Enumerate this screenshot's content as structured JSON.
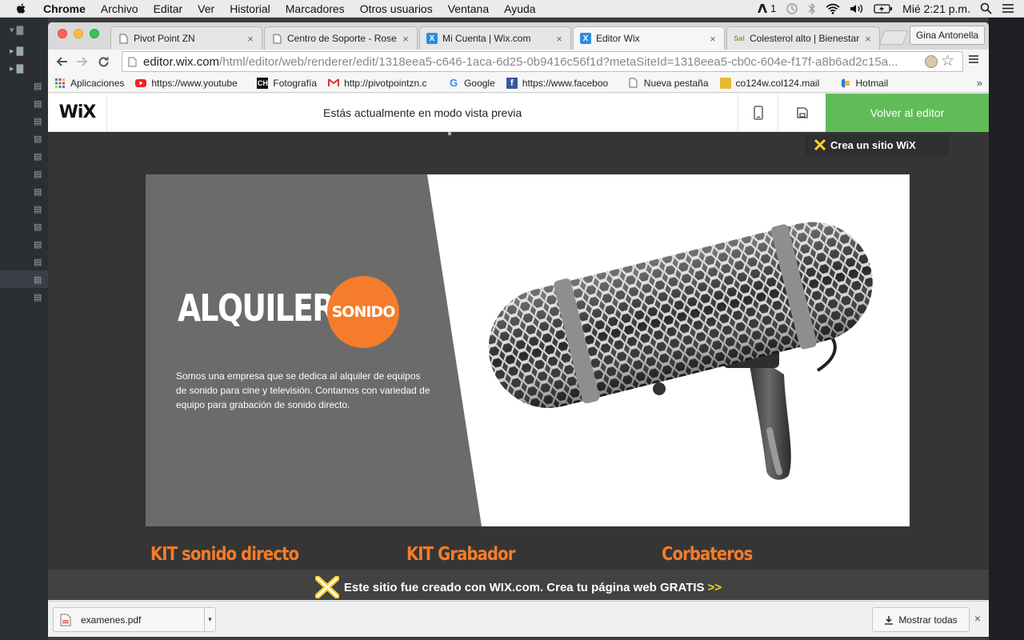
{
  "menubar": {
    "app": "Chrome",
    "items": [
      "Archivo",
      "Editar",
      "Ver",
      "Historial",
      "Marcadores",
      "Otros usuarios",
      "Ventana",
      "Ayuda"
    ],
    "status_count": "1",
    "clock": "Mié 2:21 p.m."
  },
  "tabs": [
    {
      "title": "Pivot Point ZN",
      "favicon": "page-icon",
      "active": false
    },
    {
      "title": "Centro de Soporte - Rose",
      "favicon": "page-icon",
      "active": false
    },
    {
      "title": "Mi Cuenta | Wix.com",
      "favicon": "wix-icon",
      "active": false
    },
    {
      "title": "Editor Wix",
      "favicon": "wix-icon",
      "active": true
    },
    {
      "title": "Colesterol alto | Bienestar",
      "favicon": "sal-icon",
      "active": false
    }
  ],
  "profile": "Gina Antonella",
  "omnibox": {
    "host": "editor.wix.com",
    "path": "/html/editor/web/renderer/edit/1318eea5-c646-1aca-6d25-0b9416c56f1d?metaSiteId=1318eea5-cb0c-604e-f17f-a8b6ad2c15a..."
  },
  "bookmarks": [
    {
      "label": "Aplicaciones",
      "icon": "apps-grid-icon"
    },
    {
      "label": "https://www.youtube",
      "icon": "youtube-icon"
    },
    {
      "label": "Fotografía",
      "icon": "camera-icon"
    },
    {
      "label": "http://pivotpointzn.c",
      "icon": "gmail-icon"
    },
    {
      "label": "Google",
      "icon": "google-icon"
    },
    {
      "label": "https://www.faceboo",
      "icon": "facebook-icon"
    },
    {
      "label": "Nueva pestaña",
      "icon": "page-icon"
    },
    {
      "label": "co124w.col124.mail",
      "icon": "outlook-icon"
    },
    {
      "label": "Hotmail",
      "icon": "hotmail-icon"
    }
  ],
  "wix": {
    "logo": "WiX",
    "preview_message": "Estás actualmente en modo vista previa",
    "back_to_editor": "Volver al editor",
    "create_badge": "Crea un sitio WiX"
  },
  "hero": {
    "title": "ALQUILER",
    "badge": "SONIDO",
    "description": "Somos una empresa que se dedica al alquiler de equipos de sonido para cine y televisión. Contamos con variedad de equipo para grabación de sonido directo."
  },
  "kits": [
    "KIT sonido directo",
    "KIT Grabador",
    "Corbateros"
  ],
  "footer_ad": {
    "text": "Este sitio fue creado con WIX.com. Crea tu página web GRATIS",
    "arrows": ">>"
  },
  "downloads": {
    "file": "examenes.pdf",
    "show_all": "Mostrar todas"
  },
  "colors": {
    "accent_orange": "#f57c2a",
    "wix_green": "#60bc57",
    "hero_grey": "#6b6b6b"
  }
}
